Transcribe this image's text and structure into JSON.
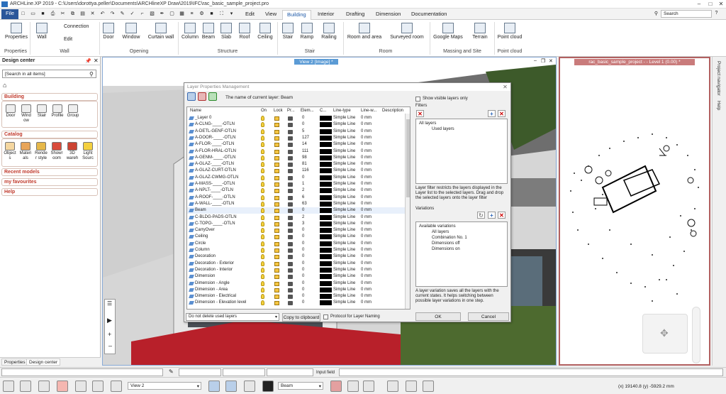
{
  "app": {
    "title": "ARCHLine.XP 2019 - C:\\Users\\dorottya.peller\\Documents\\ARCHlineXP Draw\\2019\\IFC\\rac_basic_sample_project.pro"
  },
  "ribbon_tabs": [
    "File",
    "Edit",
    "View",
    "Building",
    "Interior",
    "Drafting",
    "Dimension",
    "Documentation"
  ],
  "search": {
    "placeholder": "Search"
  },
  "ribbon": {
    "properties": "Properties",
    "wall": "Wall",
    "connection": "Connection",
    "edit": "Edit",
    "door": "Door",
    "window": "Window",
    "curtain_wall": "Curtain wall",
    "column": "Column",
    "beam": "Beam",
    "slab": "Slab",
    "roof": "Roof",
    "ceiling": "Ceiling",
    "stair": "Stair",
    "ramp": "Ramp",
    "railing": "Railing",
    "room_and_area": "Room and area",
    "surveyed_room": "Surveyed room",
    "google_maps": "Google Maps",
    "terrain": "Terrain",
    "point_cloud": "Point cloud",
    "groups": {
      "properties": "Properties",
      "wall": "Wall",
      "opening": "Opening",
      "structure": "Structure",
      "stair": "Stair",
      "room": "Room",
      "massing": "Massing and Site",
      "pointcloud": "Point cloud"
    }
  },
  "design_center": {
    "title": "Design center",
    "search": "[Search in all items]",
    "building": {
      "label": "Building",
      "items": [
        "Door",
        "Wind ow",
        "Stair",
        "Profile",
        "Group"
      ]
    },
    "catalog": {
      "label": "Catalog",
      "items": [
        "Object s",
        "Materi als",
        "Rende r style",
        "Showr oom",
        "3D wareh",
        "Light Sourc"
      ]
    },
    "recent": "Recent models",
    "favourites": "my favourites",
    "help": "Help"
  },
  "bottom_tabs": [
    "Properties",
    "Design center"
  ],
  "view2": {
    "title": "View 2 [Image] *"
  },
  "view1": {
    "title": "rac_basic_sample_project -  - Level 1 (0.00) *"
  },
  "right_strip": [
    "Project navigator",
    "Help"
  ],
  "dialog": {
    "title": "Layer Properties Management",
    "current_layer": "The name of current layer: Beam",
    "headers": [
      "Name",
      "On",
      "Lock",
      "Pr...",
      "Elem...",
      "C...",
      "Line-type",
      "Line-w...",
      "Description"
    ],
    "rows": [
      {
        "name": "_Layer 0",
        "el": "0",
        "lt": "Simple Line",
        "lw": "0 mm"
      },
      {
        "name": "A-CLNG-____-OTLN",
        "el": "0",
        "lt": "Simple Line",
        "lw": "0 mm"
      },
      {
        "name": "A-DETL-GENF-OTLN",
        "el": "5",
        "lt": "Simple Line",
        "lw": "0 mm"
      },
      {
        "name": "A-DOOR-____-OTLN",
        "el": "127",
        "lt": "Simple Line",
        "lw": "0 mm"
      },
      {
        "name": "A-FLOR-____-OTLN",
        "el": "14",
        "lt": "Simple Line",
        "lw": "0 mm"
      },
      {
        "name": "A-FLOR-HRAL-OTLN",
        "el": "111",
        "lt": "Simple Line",
        "lw": "0 mm"
      },
      {
        "name": "A-GENM-____-OTLN",
        "el": "98",
        "lt": "Simple Line",
        "lw": "0 mm"
      },
      {
        "name": "A-GLAZ-____-OTLN",
        "el": "81",
        "lt": "Simple Line",
        "lw": "0 mm"
      },
      {
        "name": "A-GLAZ-CURT-OTLN",
        "el": "116",
        "lt": "Simple Line",
        "lw": "0 mm"
      },
      {
        "name": "A-GLAZ-CWMG-OTLN",
        "el": "0",
        "lt": "Simple Line",
        "lw": "0 mm"
      },
      {
        "name": "A-MASS-____-OTLN",
        "el": "1",
        "lt": "Simple Line",
        "lw": "0 mm"
      },
      {
        "name": "A-NPLT-____-OTLN",
        "el": "2",
        "lt": "Simple Line",
        "lw": "0 mm"
      },
      {
        "name": "A-ROOF-____-OTLN",
        "el": "6",
        "lt": "Simple Line",
        "lw": "0 mm"
      },
      {
        "name": "A-WALL-____-OTLN",
        "el": "63",
        "lt": "Simple Line",
        "lw": "0 mm"
      },
      {
        "name": "Beam",
        "el": "0",
        "lt": "Simple Line",
        "lw": "0 mm",
        "sel": true
      },
      {
        "name": "C-BLDG-PADS-OTLN",
        "el": "2",
        "lt": "Simple Line",
        "lw": "0 mm"
      },
      {
        "name": "C-TOPO-____-OTLN",
        "el": "3",
        "lt": "Simple Line",
        "lw": "0 mm"
      },
      {
        "name": "CarryOver",
        "el": "0",
        "lt": "Simple Line",
        "lw": "0 mm"
      },
      {
        "name": "Ceiling",
        "el": "0",
        "lt": "Simple Line",
        "lw": "0 mm"
      },
      {
        "name": "Circle",
        "el": "0",
        "lt": "Simple Line",
        "lw": "0 mm"
      },
      {
        "name": "Column",
        "el": "0",
        "lt": "Simple Line",
        "lw": "0 mm"
      },
      {
        "name": "Decoration",
        "el": "0",
        "lt": "Simple Line",
        "lw": "0 mm"
      },
      {
        "name": "Decoration - Exterior",
        "el": "0",
        "lt": "Simple Line",
        "lw": "0 mm"
      },
      {
        "name": "Decoration - Interior",
        "el": "0",
        "lt": "Simple Line",
        "lw": "0 mm"
      },
      {
        "name": "Dimension",
        "el": "0",
        "lt": "Simple Line",
        "lw": "0 mm"
      },
      {
        "name": "Dimension - Angle",
        "el": "0",
        "lt": "Simple Line",
        "lw": "0 mm"
      },
      {
        "name": "Dimension - Area",
        "el": "0",
        "lt": "Simple Line",
        "lw": "0 mm"
      },
      {
        "name": "Dimension - Electrical",
        "el": "0",
        "lt": "Simple Line",
        "lw": "0 mm"
      },
      {
        "name": "Dimension - Elevation level",
        "el": "0",
        "lt": "Simple Line",
        "lw": "0 mm"
      }
    ],
    "show_visible": "Show visible layers only",
    "filters_label": "Filters",
    "filter_tree": [
      "All layers",
      "Used layers"
    ],
    "filter_desc": "Layer filter restricts the layers displayed in the Layer list to the selected layers. Drag and drop the selected layers onto the layer filter",
    "variations_label": "Variations",
    "variation_tree": [
      "Available variations",
      "All layers",
      "Combination No. 1",
      "Dimensions off",
      "Dimensions on"
    ],
    "variation_desc": "A layer variation saves all the layers with the current states. It helps switching between possible layer variations in one step.",
    "delete_option": "Do not delete used layers",
    "copy_btn": "Copy to clipboard",
    "protocol": "Protocol for Layer Naming",
    "ok": "OK",
    "cancel": "Cancel"
  },
  "inputbar": {
    "label": "Input field"
  },
  "statusbar": {
    "view": "View 2",
    "layer": "Beam",
    "coords": "(x) 19140.8  (y) -5929.2 mm"
  }
}
